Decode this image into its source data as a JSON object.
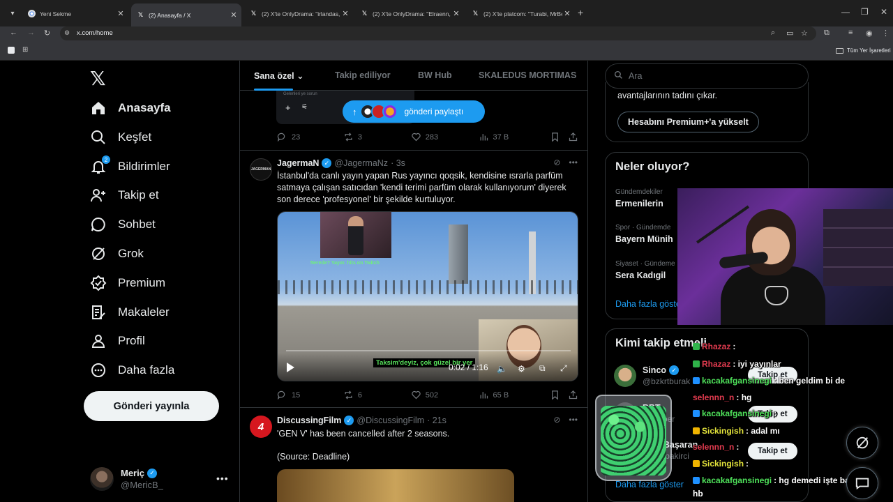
{
  "browser": {
    "tabs": [
      {
        "title": "Yeni Sekme",
        "favicon": "chrome-icon"
      },
      {
        "title": "(2) Anasayfa / X",
        "favicon": "x-icon",
        "active": true
      },
      {
        "title": "(2) X'te OnlyDrama: \"irlandas, A",
        "favicon": "x-icon"
      },
      {
        "title": "(2) X'te OnlyDrama: \"Elraenn, 2",
        "favicon": "x-icon"
      },
      {
        "title": "(2) X'te platcom: \"Turabi, MrBe",
        "favicon": "x-icon"
      }
    ],
    "url": "x.com/home",
    "bookmarks_folder": "Tüm Yer İşaretleri"
  },
  "nav": {
    "items": [
      {
        "label": "Anasayfa",
        "icon": "home-icon",
        "active": true
      },
      {
        "label": "Keşfet",
        "icon": "search-icon"
      },
      {
        "label": "Bildirimler",
        "icon": "bell-icon",
        "badge": "2"
      },
      {
        "label": "Takip et",
        "icon": "follow-icon"
      },
      {
        "label": "Sohbet",
        "icon": "chat-icon"
      },
      {
        "label": "Grok",
        "icon": "grok-icon"
      },
      {
        "label": "Premium",
        "icon": "premium-icon"
      },
      {
        "label": "Makaleler",
        "icon": "articles-icon"
      },
      {
        "label": "Profil",
        "icon": "profile-icon"
      },
      {
        "label": "Daha fazla",
        "icon": "more-icon"
      }
    ],
    "post_button": "Gönderi yayınla",
    "profile": {
      "name": "Meriç",
      "handle": "@MericB_"
    }
  },
  "feed": {
    "tabs": [
      "Sana özel",
      "Takip ediliyor",
      "BW Hub",
      "SKALEDUS MORTIMAS"
    ],
    "compose_hint": "Gelenleri ye sorun",
    "share_pill": "gönderi paylaştı",
    "post1_stats": {
      "replies": "23",
      "reposts": "3",
      "likes": "283",
      "views": "37 B"
    },
    "post2": {
      "name": "JagermaN",
      "handle": "@JagermaNz",
      "time": "· 3s",
      "avatar_text": "JAGERMAN",
      "text": "İstanbul'da canlı yayın yapan Rus yayıncı qoqsik, kendisine ısrarla parfüm satmaya çalışan satıcıdan 'kendi terimi parfüm olarak kullanıyorum' diyerek son derece 'profesyonel' bir şekilde kurtuluyor.",
      "subtitle": "Taksim'deyiz, çok güzel bir yer",
      "overlay_caption": "Nerede? Yayın: hits on Twitch",
      "video_time": "0:02 / 1:16",
      "stats": {
        "replies": "15",
        "reposts": "6",
        "likes": "502",
        "views": "65 B"
      }
    },
    "post3": {
      "name": "DiscussingFilm",
      "handle": "@DiscussingFilm",
      "time": "· 21s",
      "avatar_text": "4",
      "text1": "'GEN V' has been cancelled after 2 seasons.",
      "text2": "(Source: Deadline)"
    }
  },
  "right": {
    "search_placeholder": "Ara",
    "premium_text": "avantajlarının tadını çıkar.",
    "premium_button": "Hesabını Premium+'a yükselt",
    "trends_title": "Neler oluyor?",
    "trends": [
      {
        "category": "Gündemdekiler",
        "name": "Ermenilerin"
      },
      {
        "category": "Spor · Gündemde",
        "name": "Bayern Münih"
      },
      {
        "category": "Siyaset · Gündeme",
        "name": "Sera Kadıgil"
      }
    ],
    "trends_more": "Daha fazla göster",
    "who_title": "Kimi takip etmeli",
    "who": [
      {
        "name": "Sinco",
        "handle": "@bzkrtburak",
        "button": "Takip et"
      },
      {
        "name": "BBT",
        "handle": "@...aber",
        "button": "Takip et"
      },
      {
        "name": "Mert Başaran",
        "handle": "@...mbakirci",
        "button": "Takip et"
      }
    ],
    "who_more": "Daha fazla göster"
  },
  "chat": [
    {
      "user": "Rhazaz",
      "color": "#e23b4f",
      "message": ":"
    },
    {
      "user": "Rhazaz",
      "color": "#e23b4f",
      "message": ": iyi yayınlar"
    },
    {
      "user": "kacakafgansinegi",
      "color": "#4fe35b",
      "message": ": ben geldim bi de"
    },
    {
      "user": "selennn_n",
      "color": "#e23b4f",
      "message": ": hg"
    },
    {
      "user": "kacakafgansinegi",
      "color": "#4fe35b",
      "message": ":"
    },
    {
      "user": "Sickingish",
      "color": "#e3e33b",
      "message": ": adal mı"
    },
    {
      "user": "selennn_n",
      "color": "#e23b4f",
      "message": ":"
    },
    {
      "user": "Sickingish",
      "color": "#e3e33b",
      "message": ":"
    },
    {
      "user": "kacakafgansinegi",
      "color": "#4fe35b",
      "message": ": hg demedi işte bana"
    },
    {
      "user": "",
      "color": "#ffffff",
      "message": "hb"
    }
  ],
  "colors": {
    "accent": "#1d9bf0",
    "background": "#000000",
    "border": "#2f3336",
    "muted": "#71767b"
  }
}
